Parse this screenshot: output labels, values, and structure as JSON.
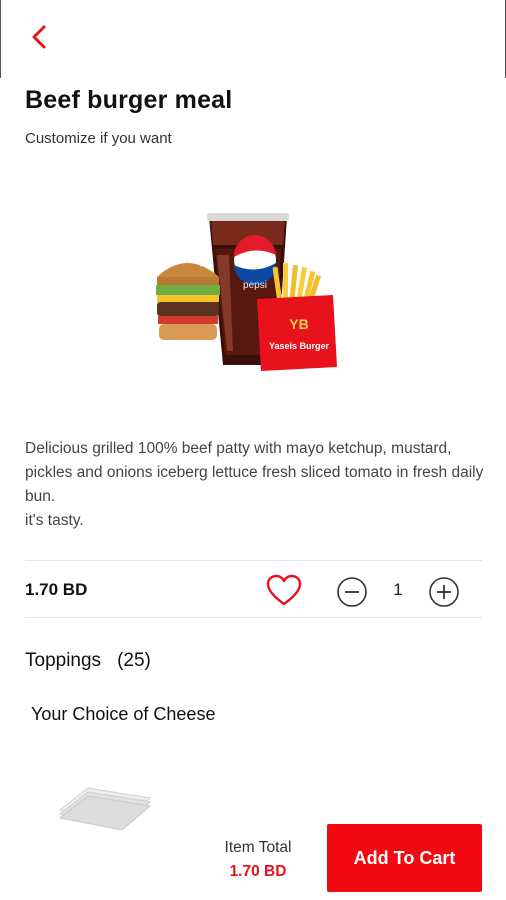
{
  "header": {
    "back_icon": "chevron-left-icon"
  },
  "product": {
    "title": "Beef burger meal",
    "subtitle": "Customize if you want",
    "image_brand_text": "pepsi",
    "image_bag_text": "Yaseis Burger",
    "description_line1": "Delicious grilled 100% beef patty with mayo ketchup, mustard, pickles and onions iceberg lettuce fresh sliced tomato in fresh daily bun.",
    "description_line2": "it's tasty.",
    "price": "1.70 BD",
    "favorite_icon": "heart-icon",
    "quantity": "1"
  },
  "toppings": {
    "label": "Toppings",
    "count": "(25)",
    "group_label": "Your Choice of Cheese"
  },
  "footer": {
    "item_total_label": "Item Total",
    "item_total_value": "1.70 BD",
    "add_to_cart_label": "Add To Cart"
  },
  "colors": {
    "accent": "#f20a13",
    "price_red": "#e8121c"
  }
}
